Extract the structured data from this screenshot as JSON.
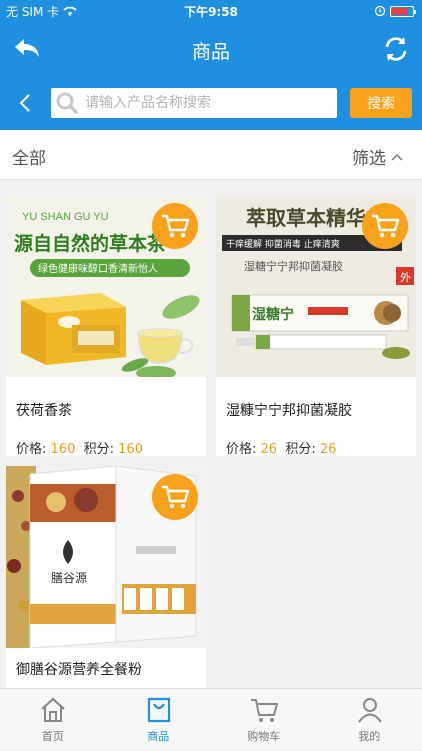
{
  "status_bar": {
    "carrier": "无 SIM 卡",
    "time": "下午9:58"
  },
  "nav": {
    "title": "商品"
  },
  "search": {
    "placeholder": "请输入产品名称搜索",
    "button_label": "搜索"
  },
  "filter": {
    "all_label": "全部",
    "sort_label": "筛选"
  },
  "products": [
    {
      "name": "茯荷香茶",
      "price_label": "价格:",
      "price": "160",
      "points_label": "积分:",
      "points": "160",
      "image_text": {
        "line1": "YU SHAN GU YU",
        "line2": "源自自然的草本茶",
        "line3": "绿色健康味醇口香清新怡人"
      }
    },
    {
      "name": "湿糠宁宁邦抑菌凝胶",
      "price_label": "价格:",
      "price": "26",
      "points_label": "积分:",
      "points": "26",
      "image_text": {
        "line1": "萃取草本精华",
        "line2": "干痒缓解 抑菌消毒 止痒清爽",
        "line3": "湿糖宁宁邦抑菌凝胶",
        "brand": "湿糖宁",
        "tag": "外"
      }
    },
    {
      "name": "御膳谷源营养全餐粉",
      "image_text": {
        "brand": "膳谷源"
      }
    }
  ],
  "tabs": [
    {
      "label": "首页",
      "icon": "home-icon"
    },
    {
      "label": "商品",
      "icon": "bag-icon"
    },
    {
      "label": "购物车",
      "icon": "cart-icon"
    },
    {
      "label": "我的",
      "icon": "user-icon"
    }
  ],
  "colors": {
    "primary": "#1f8fe0",
    "accent": "#f7a21a",
    "price": "#f29a1b"
  }
}
